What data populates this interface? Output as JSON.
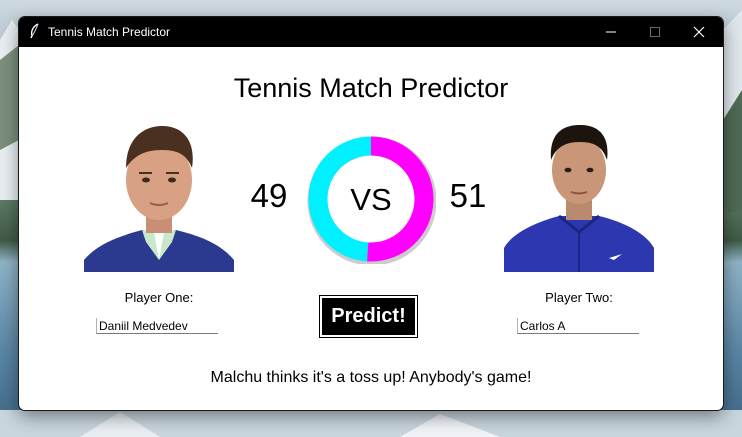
{
  "window": {
    "title": "Tennis Match Predictor"
  },
  "main": {
    "heading": "Tennis Match Predictor",
    "vs_label": "VS",
    "gauge": {
      "player_one_percent": 49,
      "player_two_percent": 51,
      "player_one_color": "#00f0ff",
      "player_two_color": "#ff00ff"
    },
    "player_one": {
      "score": "49",
      "label": "Player One:",
      "input_value": "Daniil Medvedev"
    },
    "player_two": {
      "score": "51",
      "label": "Player Two:",
      "input_value": "Carlos A"
    },
    "predict_button": "Predict!",
    "message": "Malchu thinks it's a toss up! Anybody's game!"
  },
  "icons": {
    "app": "feather-icon",
    "minimize": "minimize-icon",
    "maximize": "maximize-icon",
    "close": "close-icon"
  }
}
